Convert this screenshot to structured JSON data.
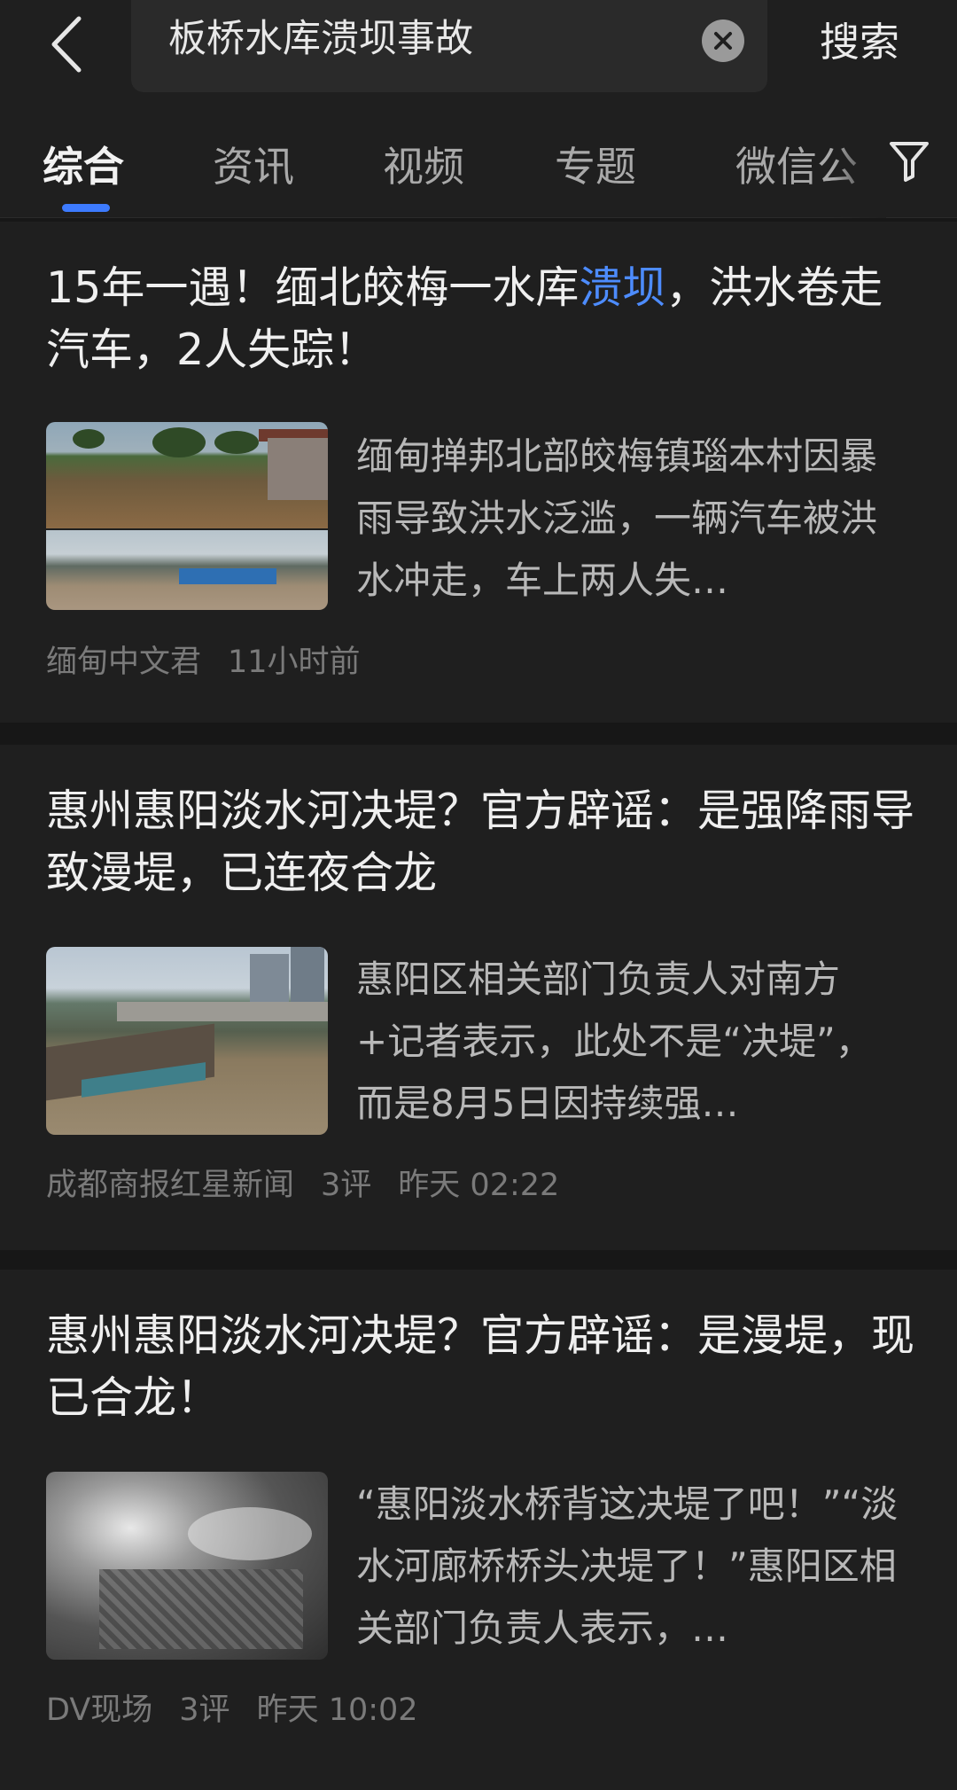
{
  "search": {
    "query": "板桥水库溃坝事故",
    "submit_label": "搜索"
  },
  "tabs": [
    {
      "label": "综合",
      "active": true
    },
    {
      "label": "资讯",
      "active": false
    },
    {
      "label": "视频",
      "active": false
    },
    {
      "label": "专题",
      "active": false
    },
    {
      "label": "微信公",
      "active": false
    }
  ],
  "feed": [
    {
      "title_before": "15年一遇！缅北皎梅一水库",
      "title_highlight": "溃坝",
      "title_after": "，洪水卷走汽车，2人失踪！",
      "summary": "缅甸掸邦北部皎梅镇瑙本村因暴雨导致洪水泛滥，一辆汽车被洪水冲走，车上两人失…",
      "source": "缅甸中文君",
      "comments": "",
      "time": "11小时前"
    },
    {
      "title": "惠州惠阳淡水河决堤？官方辟谣：是强降雨导致漫堤，已连夜合龙",
      "summary": "惠阳区相关部门负责人对南方+记者表示，此处不是“决堤”，而是8月5日因持续强…",
      "source": "成都商报红星新闻",
      "comments": "3评",
      "time": "昨天 02:22"
    },
    {
      "title": "惠州惠阳淡水河决堤？官方辟谣：是漫堤，现已合龙！",
      "summary": "“惠阳淡水桥背这决堤了吧！”“淡水河廊桥桥头决堤了！”惠阳区相关部门负责人表示，…",
      "source": "DV现场",
      "comments": "3评",
      "time": "昨天 10:02"
    }
  ],
  "colors": {
    "accent": "#3d7bff",
    "highlight": "#4d8cff",
    "background": "#171717",
    "card": "#1f1f1f"
  }
}
